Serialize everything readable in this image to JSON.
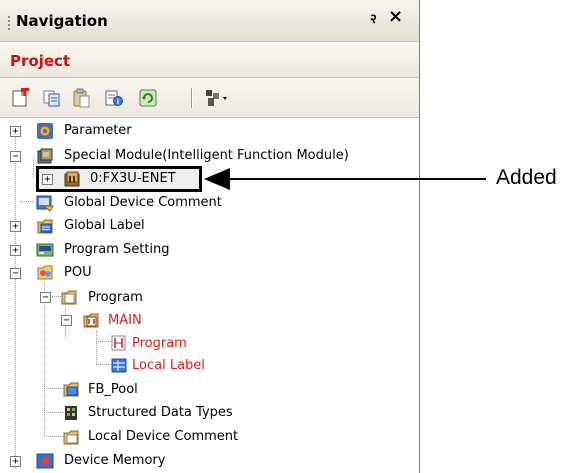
{
  "panel": {
    "title": "Navigation",
    "pin_glyph": "२",
    "close_glyph": "×",
    "section": "Project",
    "toolbar": [
      {
        "name": "new-data-icon"
      },
      {
        "name": "copy-icon"
      },
      {
        "name": "paste-icon"
      },
      {
        "name": "properties-icon"
      },
      {
        "name": "refresh-icon"
      },
      {
        "name": "display-filter-icon"
      }
    ]
  },
  "tree": {
    "items": [
      {
        "label": "Parameter"
      },
      {
        "label": "Special Module(Intelligent Function Module)"
      },
      {
        "label": "0:FX3U-ENET"
      },
      {
        "label": "Global Device Comment"
      },
      {
        "label": "Global Label"
      },
      {
        "label": "Program Setting"
      },
      {
        "label": "POU"
      },
      {
        "label": "Program"
      },
      {
        "label": "MAIN"
      },
      {
        "label": "Program"
      },
      {
        "label": "Local Label"
      },
      {
        "label": "FB_Pool"
      },
      {
        "label": "Structured Data Types"
      },
      {
        "label": "Local Device Comment"
      },
      {
        "label": "Device Memory"
      }
    ],
    "expand_plus": "+",
    "expand_minus": "−"
  },
  "annotation": {
    "text": "Added"
  },
  "colors": {
    "red_text": "#e31b1b",
    "section_red": "#cc1111"
  }
}
